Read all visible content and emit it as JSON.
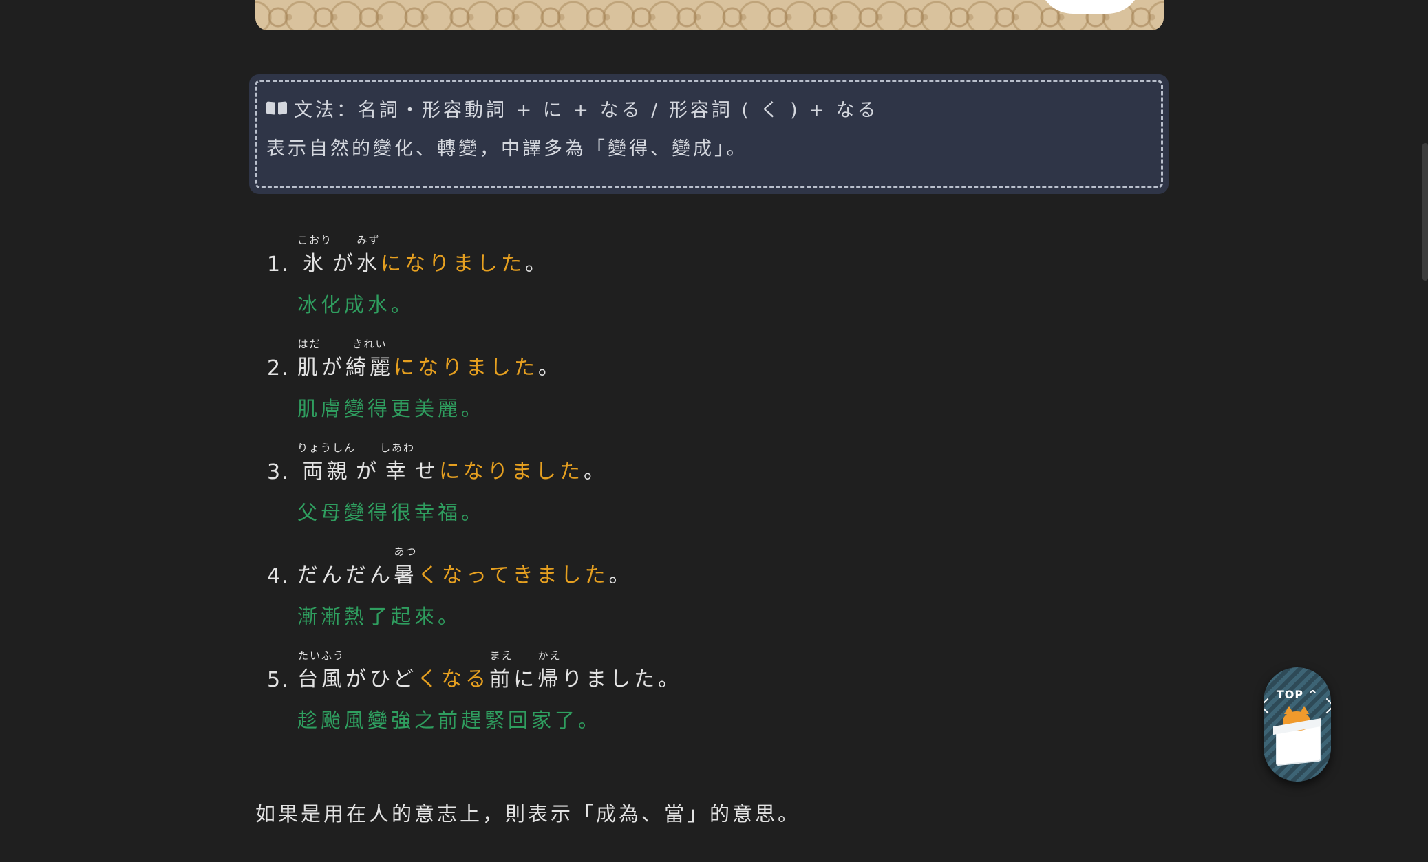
{
  "banner": {
    "decorative": "chinese-lattice-pattern"
  },
  "grammar": {
    "icon": "book-icon",
    "title": "文法：名詞・形容動詞 + に + なる / 形容詞 ( く ) + なる",
    "description": "表示自然的變化、轉變，中譯多為「變得、變成」。"
  },
  "examples": [
    {
      "num": "1.",
      "jp": [
        {
          "t": "氷",
          "r": "こおり"
        },
        {
          "t": "が"
        },
        {
          "t": "水",
          "r": "みず"
        },
        {
          "t": "になりました",
          "hl": true
        },
        {
          "t": "。"
        }
      ],
      "zh": "冰化成水。"
    },
    {
      "num": "2.",
      "jp": [
        {
          "t": "肌",
          "r": "はだ"
        },
        {
          "t": "が"
        },
        {
          "t": "綺麗",
          "r": "きれい"
        },
        {
          "t": "になりました",
          "hl": true
        },
        {
          "t": "。"
        }
      ],
      "zh": "肌膚變得更美麗。"
    },
    {
      "num": "3.",
      "jp": [
        {
          "t": "両親",
          "r": "りょうしん"
        },
        {
          "t": "が"
        },
        {
          "t": "幸",
          "r": "しあわ"
        },
        {
          "t": "せ"
        },
        {
          "t": "になりました",
          "hl": true
        },
        {
          "t": "。"
        }
      ],
      "zh": "父母變得很幸福。"
    },
    {
      "num": "4.",
      "jp": [
        {
          "t": "だんだん"
        },
        {
          "t": "暑",
          "r": "あつ"
        },
        {
          "t": "くなってきました",
          "hl": true
        },
        {
          "t": "。"
        }
      ],
      "zh": "漸漸熱了起來。"
    },
    {
      "num": "5.",
      "jp": [
        {
          "t": "台風",
          "r": "たいふう"
        },
        {
          "t": "がひど"
        },
        {
          "t": "くなる",
          "hl": true
        },
        {
          "t": "前",
          "r": "まえ"
        },
        {
          "t": "に"
        },
        {
          "t": "帰",
          "r": "かえ"
        },
        {
          "t": "りました。"
        }
      ],
      "zh": "趁颱風變強之前趕緊回家了。"
    }
  ],
  "footnote": "如果是用在人的意志上，則表示「成為、當」的意思。",
  "top_button": {
    "label": "TOP",
    "icon": "chevron-up-icon",
    "mascot": "cat-in-box-icon"
  }
}
